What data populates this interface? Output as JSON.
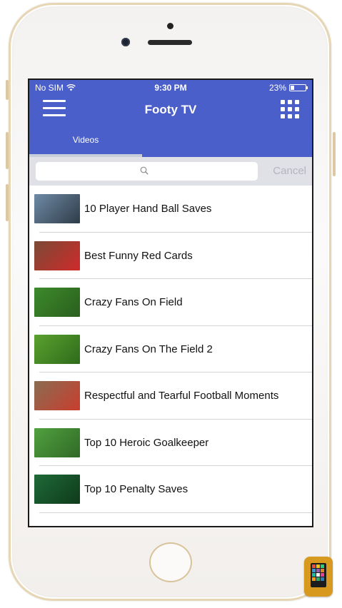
{
  "status_bar": {
    "carrier": "No SIM",
    "time": "9:30 PM",
    "battery": "23%",
    "battery_level": 0.23
  },
  "navbar": {
    "title": "Footy TV",
    "background": "#4a5fc9"
  },
  "tabs": [
    {
      "label": "Videos",
      "selected": true
    }
  ],
  "search": {
    "placeholder": "",
    "cancel_label": "Cancel"
  },
  "videos": [
    {
      "title": "10 Player Hand Ball Saves",
      "thumb_colors": [
        "#6f8aa6",
        "#2f3c48"
      ]
    },
    {
      "title": "Best Funny Red Cards",
      "thumb_colors": [
        "#7a4a36",
        "#cf2a2a"
      ]
    },
    {
      "title": "Crazy Fans On Field",
      "thumb_colors": [
        "#3d8a2c",
        "#2a5f1d"
      ]
    },
    {
      "title": "Crazy Fans On The Field 2",
      "thumb_colors": [
        "#5aa12f",
        "#2e6b1b"
      ]
    },
    {
      "title": "Respectful and Tearful Football Moments",
      "thumb_colors": [
        "#8a6d52",
        "#c93d2e"
      ]
    },
    {
      "title": "Top 10 Heroic Goalkeeper",
      "thumb_colors": [
        "#52a040",
        "#2f6a26"
      ]
    },
    {
      "title": "Top 10 Penalty Saves",
      "thumb_colors": [
        "#1f6a37",
        "#0f3a1c"
      ]
    }
  ]
}
